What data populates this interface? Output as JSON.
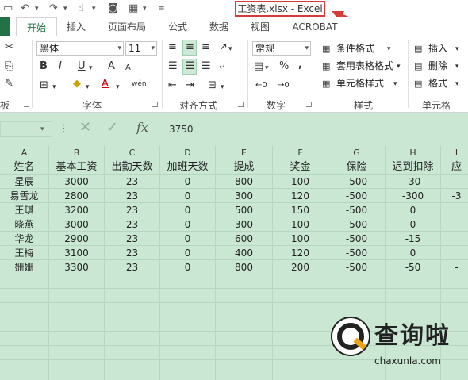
{
  "title_bar": {
    "window_title": "工资表.xlsx - Excel",
    "qat_icons": [
      "undo-icon",
      "redo-icon",
      "touch-mode-icon",
      "camera-icon",
      "form-icon",
      "customize-qat-icon"
    ]
  },
  "tabs": [
    "开始",
    "插入",
    "页面布局",
    "公式",
    "数据",
    "视图",
    "ACROBAT"
  ],
  "ribbon": {
    "font_name": "黑体",
    "font_size": "11",
    "number_format": "常规",
    "group_labels": {
      "clipboard": "板",
      "font": "字体",
      "alignment": "对齐方式",
      "number": "数字",
      "styles": "样式",
      "cells": "单元格"
    },
    "styles_buttons": [
      "条件格式",
      "套用表格格式",
      "单元格样式"
    ],
    "cells_buttons": [
      "插入",
      "删除",
      "格式"
    ],
    "font_buttons": {
      "bold": "B",
      "italic": "I",
      "underline": "U",
      "grow": "A",
      "shrink": "A",
      "font_color": "A",
      "phonetic": "wén"
    },
    "number_buttons": {
      "percent": "%",
      "comma": ","
    }
  },
  "formula_bar": {
    "value": "3750",
    "fx_label": "fx"
  },
  "sheet": {
    "columns": [
      "A",
      "B",
      "C",
      "D",
      "E",
      "F",
      "G",
      "H",
      "I"
    ],
    "header_row": [
      "姓名",
      "基本工资",
      "出勤天数",
      "加班天数",
      "提成",
      "奖金",
      "保险",
      "迟到扣除",
      "应"
    ],
    "rows": [
      [
        "星辰",
        "3000",
        "23",
        "0",
        "800",
        "100",
        "-500",
        "-30",
        "-"
      ],
      [
        "易雪龙",
        "2800",
        "23",
        "0",
        "300",
        "120",
        "-500",
        "-300",
        "-3"
      ],
      [
        "王琪",
        "3200",
        "23",
        "0",
        "500",
        "150",
        "-500",
        "0",
        ""
      ],
      [
        "晓燕",
        "3000",
        "23",
        "0",
        "300",
        "100",
        "-500",
        "0",
        ""
      ],
      [
        "华龙",
        "2900",
        "23",
        "0",
        "600",
        "100",
        "-500",
        "-15",
        ""
      ],
      [
        "王梅",
        "3100",
        "23",
        "0",
        "400",
        "120",
        "-500",
        "0",
        ""
      ],
      [
        "姗姗",
        "3300",
        "23",
        "0",
        "800",
        "200",
        "-500",
        "-50",
        "-"
      ]
    ]
  },
  "watermark": {
    "text": "查询啦",
    "url": "chaxunla.com"
  },
  "colors": {
    "accent": "#217346",
    "sheet_bg": "#c9e7d3",
    "highlight_box": "#d63a3a"
  }
}
